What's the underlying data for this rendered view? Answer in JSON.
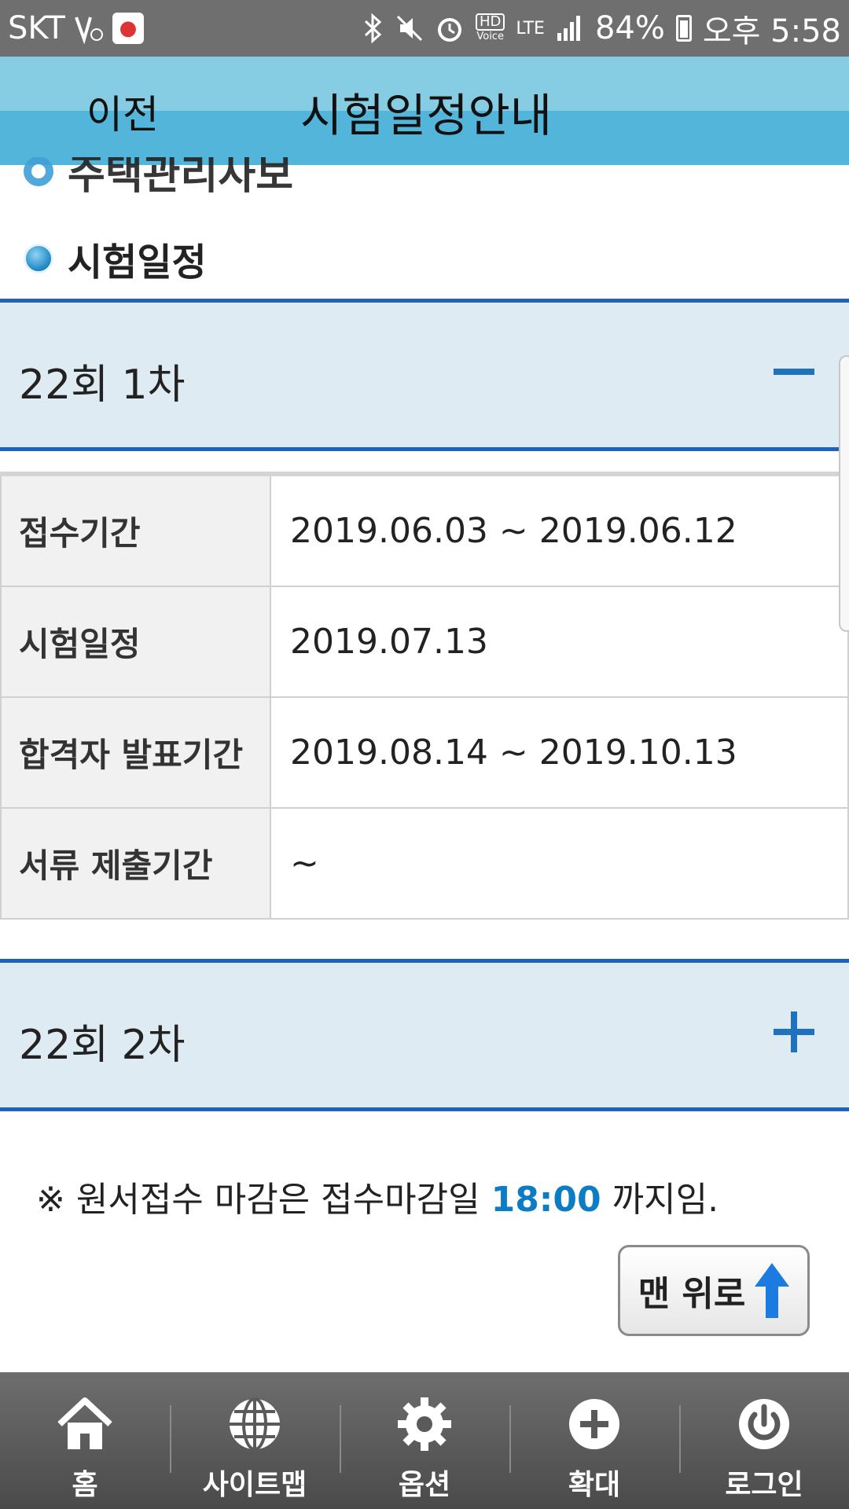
{
  "status_bar": {
    "carrier": "SKT",
    "battery": "84%",
    "time": "오후 5:58",
    "network": "LTE",
    "hd_voice": "HD",
    "hd_voice_sub": "Voice"
  },
  "header": {
    "back_label": "이전",
    "title": "시험일정안내"
  },
  "sections": {
    "partial_heading": "주택관리사보",
    "main_heading": "시험일정"
  },
  "schedule": {
    "round1": {
      "label": "22회 1차",
      "expanded": true,
      "rows": [
        {
          "label": "접수기간",
          "value": "2019.06.03 ~ 2019.06.12"
        },
        {
          "label": "시험일정",
          "value": "2019.07.13"
        },
        {
          "label": "합격자 발표기간",
          "value": "2019.08.14 ~ 2019.10.13"
        },
        {
          "label": "서류 제출기간",
          "value": "~"
        }
      ]
    },
    "round2": {
      "label": "22회 2차",
      "expanded": false
    }
  },
  "notice": {
    "prefix": "※ 원서접수 마감은 접수마감일 ",
    "highlight": "18:00",
    "suffix": " 까지임."
  },
  "top_button": {
    "label": "맨 위로"
  },
  "bottom_nav": [
    {
      "label": "홈",
      "icon": "home-icon"
    },
    {
      "label": "사이트맵",
      "icon": "globe-icon"
    },
    {
      "label": "옵션",
      "icon": "gear-icon"
    },
    {
      "label": "확대",
      "icon": "plus-circle-icon"
    },
    {
      "label": "로그인",
      "icon": "power-icon"
    }
  ],
  "colors": {
    "header_light": "#86cde4",
    "header_dark": "#54b5da",
    "accent_blue": "#1e63b6",
    "highlight_time": "#0c7cc4",
    "accordion_bg": "#deebf2"
  }
}
